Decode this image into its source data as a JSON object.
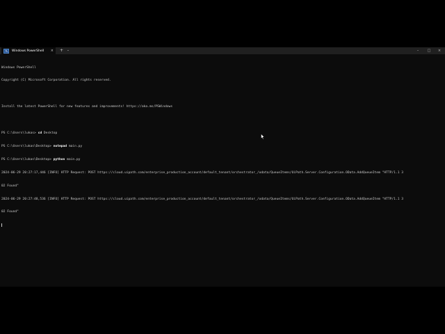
{
  "window": {
    "tab_title": "Windows PowerShell",
    "tab_close": "×",
    "new_tab": "+",
    "dropdown": "⌄",
    "minimize": "–",
    "maximize": "□",
    "close": "×"
  },
  "terminal": {
    "lines": [
      {
        "prefix": "Windows PowerShell",
        "cmd": "",
        "rest": ""
      },
      {
        "prefix": "Copyright (C) Microsoft Corporation. All rights reserved.",
        "cmd": "",
        "rest": ""
      },
      {
        "prefix": "",
        "cmd": "",
        "rest": ""
      },
      {
        "prefix": "Install the latest PowerShell for new features and improvements! https://aka.ms/PSWindows",
        "cmd": "",
        "rest": ""
      },
      {
        "prefix": "",
        "cmd": "",
        "rest": ""
      },
      {
        "prefix": "PS C:\\Users\\lukas> ",
        "cmd": "cd",
        "rest": " Desktop"
      },
      {
        "prefix": "PS C:\\Users\\lukas\\Desktop> ",
        "cmd": "notepad",
        "rest": " main.py"
      },
      {
        "prefix": "PS C:\\Users\\lukas\\Desktop> ",
        "cmd": "python",
        "rest": " main.py"
      },
      {
        "prefix": "2024-06-29 20:27:17,446 [INFO] HTTP Request: POST https://cloud.uipath.com/enterprise_production_account/default_tenant/orchestrator_/odata/QueueItems/UiPath.Server.Configuration.OData.AddQueueItem \"HTTP/1.1 3",
        "cmd": "",
        "rest": ""
      },
      {
        "prefix": "02 Found\"",
        "cmd": "",
        "rest": ""
      },
      {
        "prefix": "2024-06-29 20:27:48,536 [INFO] HTTP Request: POST https://cloud.uipath.com/enterprise_production_account/default_tenant/orchestrator_/odata/QueueItems/UiPath.Server.Configuration.OData.AddQueueItem \"HTTP/1.1 3",
        "cmd": "",
        "rest": ""
      },
      {
        "prefix": "02 Found\"",
        "cmd": "",
        "rest": ""
      }
    ]
  },
  "colors": {
    "terminal_bg": "#0c0c0c",
    "titlebar_bg": "#202020",
    "text": "#cccccc",
    "powershell_icon": "#2b5797"
  }
}
